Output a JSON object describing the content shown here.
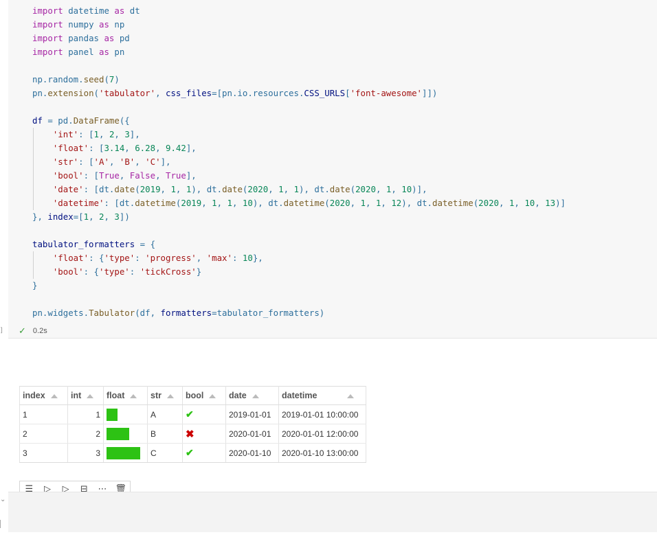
{
  "code_lines": [
    [
      {
        "t": "import",
        "c": "kw"
      },
      {
        "t": " datetime ",
        "c": "plain"
      },
      {
        "t": "as",
        "c": "kw"
      },
      {
        "t": " dt",
        "c": "plain"
      }
    ],
    [
      {
        "t": "import",
        "c": "kw"
      },
      {
        "t": " numpy ",
        "c": "plain"
      },
      {
        "t": "as",
        "c": "kw"
      },
      {
        "t": " np",
        "c": "plain"
      }
    ],
    [
      {
        "t": "import",
        "c": "kw"
      },
      {
        "t": " pandas ",
        "c": "plain"
      },
      {
        "t": "as",
        "c": "kw"
      },
      {
        "t": " pd",
        "c": "plain"
      }
    ],
    [
      {
        "t": "import",
        "c": "kw"
      },
      {
        "t": " panel ",
        "c": "plain"
      },
      {
        "t": "as",
        "c": "kw"
      },
      {
        "t": " pn",
        "c": "plain"
      }
    ],
    [],
    [
      {
        "t": "np.random.",
        "c": "plain"
      },
      {
        "t": "seed",
        "c": "fn"
      },
      {
        "t": "(",
        "c": "plain"
      },
      {
        "t": "7",
        "c": "num"
      },
      {
        "t": ")",
        "c": "plain"
      }
    ],
    [
      {
        "t": "pn.",
        "c": "plain"
      },
      {
        "t": "extension",
        "c": "fn"
      },
      {
        "t": "(",
        "c": "plain"
      },
      {
        "t": "'tabulator'",
        "c": "str"
      },
      {
        "t": ", ",
        "c": "plain"
      },
      {
        "t": "css_files",
        "c": "ident"
      },
      {
        "t": "=[pn.io.resources.",
        "c": "plain"
      },
      {
        "t": "CSS_URLS",
        "c": "ident"
      },
      {
        "t": "[",
        "c": "plain"
      },
      {
        "t": "'font-awesome'",
        "c": "str"
      },
      {
        "t": "]])",
        "c": "plain"
      }
    ],
    [],
    [
      {
        "t": "df ",
        "c": "ident"
      },
      {
        "t": "= pd.",
        "c": "plain"
      },
      {
        "t": "DataFrame",
        "c": "fn"
      },
      {
        "t": "({",
        "c": "plain"
      }
    ],
    [
      {
        "t": "    ",
        "c": "plain"
      },
      {
        "t": "'int'",
        "c": "str"
      },
      {
        "t": ": [",
        "c": "plain"
      },
      {
        "t": "1",
        "c": "num"
      },
      {
        "t": ", ",
        "c": "plain"
      },
      {
        "t": "2",
        "c": "num"
      },
      {
        "t": ", ",
        "c": "plain"
      },
      {
        "t": "3",
        "c": "num"
      },
      {
        "t": "],",
        "c": "plain"
      }
    ],
    [
      {
        "t": "    ",
        "c": "plain"
      },
      {
        "t": "'float'",
        "c": "str"
      },
      {
        "t": ": [",
        "c": "plain"
      },
      {
        "t": "3.14",
        "c": "num"
      },
      {
        "t": ", ",
        "c": "plain"
      },
      {
        "t": "6.28",
        "c": "num"
      },
      {
        "t": ", ",
        "c": "plain"
      },
      {
        "t": "9.42",
        "c": "num"
      },
      {
        "t": "],",
        "c": "plain"
      }
    ],
    [
      {
        "t": "    ",
        "c": "plain"
      },
      {
        "t": "'str'",
        "c": "str"
      },
      {
        "t": ": [",
        "c": "plain"
      },
      {
        "t": "'A'",
        "c": "str"
      },
      {
        "t": ", ",
        "c": "plain"
      },
      {
        "t": "'B'",
        "c": "str"
      },
      {
        "t": ", ",
        "c": "plain"
      },
      {
        "t": "'C'",
        "c": "str"
      },
      {
        "t": "],",
        "c": "plain"
      }
    ],
    [
      {
        "t": "    ",
        "c": "plain"
      },
      {
        "t": "'bool'",
        "c": "str"
      },
      {
        "t": ": [",
        "c": "plain"
      },
      {
        "t": "True",
        "c": "kw"
      },
      {
        "t": ", ",
        "c": "plain"
      },
      {
        "t": "False",
        "c": "kw"
      },
      {
        "t": ", ",
        "c": "plain"
      },
      {
        "t": "True",
        "c": "kw"
      },
      {
        "t": "],",
        "c": "plain"
      }
    ],
    [
      {
        "t": "    ",
        "c": "plain"
      },
      {
        "t": "'date'",
        "c": "str"
      },
      {
        "t": ": [dt.",
        "c": "plain"
      },
      {
        "t": "date",
        "c": "fn"
      },
      {
        "t": "(",
        "c": "plain"
      },
      {
        "t": "2019",
        "c": "num"
      },
      {
        "t": ", ",
        "c": "plain"
      },
      {
        "t": "1",
        "c": "num"
      },
      {
        "t": ", ",
        "c": "plain"
      },
      {
        "t": "1",
        "c": "num"
      },
      {
        "t": "), dt.",
        "c": "plain"
      },
      {
        "t": "date",
        "c": "fn"
      },
      {
        "t": "(",
        "c": "plain"
      },
      {
        "t": "2020",
        "c": "num"
      },
      {
        "t": ", ",
        "c": "plain"
      },
      {
        "t": "1",
        "c": "num"
      },
      {
        "t": ", ",
        "c": "plain"
      },
      {
        "t": "1",
        "c": "num"
      },
      {
        "t": "), dt.",
        "c": "plain"
      },
      {
        "t": "date",
        "c": "fn"
      },
      {
        "t": "(",
        "c": "plain"
      },
      {
        "t": "2020",
        "c": "num"
      },
      {
        "t": ", ",
        "c": "plain"
      },
      {
        "t": "1",
        "c": "num"
      },
      {
        "t": ", ",
        "c": "plain"
      },
      {
        "t": "10",
        "c": "num"
      },
      {
        "t": ")],",
        "c": "plain"
      }
    ],
    [
      {
        "t": "    ",
        "c": "plain"
      },
      {
        "t": "'datetime'",
        "c": "str"
      },
      {
        "t": ": [dt.",
        "c": "plain"
      },
      {
        "t": "datetime",
        "c": "fn"
      },
      {
        "t": "(",
        "c": "plain"
      },
      {
        "t": "2019",
        "c": "num"
      },
      {
        "t": ", ",
        "c": "plain"
      },
      {
        "t": "1",
        "c": "num"
      },
      {
        "t": ", ",
        "c": "plain"
      },
      {
        "t": "1",
        "c": "num"
      },
      {
        "t": ", ",
        "c": "plain"
      },
      {
        "t": "10",
        "c": "num"
      },
      {
        "t": "), dt.",
        "c": "plain"
      },
      {
        "t": "datetime",
        "c": "fn"
      },
      {
        "t": "(",
        "c": "plain"
      },
      {
        "t": "2020",
        "c": "num"
      },
      {
        "t": ", ",
        "c": "plain"
      },
      {
        "t": "1",
        "c": "num"
      },
      {
        "t": ", ",
        "c": "plain"
      },
      {
        "t": "1",
        "c": "num"
      },
      {
        "t": ", ",
        "c": "plain"
      },
      {
        "t": "12",
        "c": "num"
      },
      {
        "t": "), dt.",
        "c": "plain"
      },
      {
        "t": "datetime",
        "c": "fn"
      },
      {
        "t": "(",
        "c": "plain"
      },
      {
        "t": "2020",
        "c": "num"
      },
      {
        "t": ", ",
        "c": "plain"
      },
      {
        "t": "1",
        "c": "num"
      },
      {
        "t": ", ",
        "c": "plain"
      },
      {
        "t": "10",
        "c": "num"
      },
      {
        "t": ", ",
        "c": "plain"
      },
      {
        "t": "13",
        "c": "num"
      },
      {
        "t": ")]",
        "c": "plain"
      }
    ],
    [
      {
        "t": "}, ",
        "c": "plain"
      },
      {
        "t": "index",
        "c": "ident"
      },
      {
        "t": "=[",
        "c": "plain"
      },
      {
        "t": "1",
        "c": "num"
      },
      {
        "t": ", ",
        "c": "plain"
      },
      {
        "t": "2",
        "c": "num"
      },
      {
        "t": ", ",
        "c": "plain"
      },
      {
        "t": "3",
        "c": "num"
      },
      {
        "t": "])",
        "c": "plain"
      }
    ],
    [],
    [
      {
        "t": "tabulator_formatters ",
        "c": "ident"
      },
      {
        "t": "= {",
        "c": "plain"
      }
    ],
    [
      {
        "t": "    ",
        "c": "plain"
      },
      {
        "t": "'float'",
        "c": "str"
      },
      {
        "t": ": {",
        "c": "plain"
      },
      {
        "t": "'type'",
        "c": "str"
      },
      {
        "t": ": ",
        "c": "plain"
      },
      {
        "t": "'progress'",
        "c": "str"
      },
      {
        "t": ", ",
        "c": "plain"
      },
      {
        "t": "'max'",
        "c": "str"
      },
      {
        "t": ": ",
        "c": "plain"
      },
      {
        "t": "10",
        "c": "num"
      },
      {
        "t": "},",
        "c": "plain"
      }
    ],
    [
      {
        "t": "    ",
        "c": "plain"
      },
      {
        "t": "'bool'",
        "c": "str"
      },
      {
        "t": ": {",
        "c": "plain"
      },
      {
        "t": "'type'",
        "c": "str"
      },
      {
        "t": ": ",
        "c": "plain"
      },
      {
        "t": "'tickCross'",
        "c": "str"
      },
      {
        "t": "}",
        "c": "plain"
      }
    ],
    [
      {
        "t": "}",
        "c": "plain"
      }
    ],
    [],
    [
      {
        "t": "pn.widgets.",
        "c": "plain"
      },
      {
        "t": "Tabulator",
        "c": "fn"
      },
      {
        "t": "(df, ",
        "c": "plain"
      },
      {
        "t": "formatters",
        "c": "ident"
      },
      {
        "t": "=tabulator_formatters)",
        "c": "plain"
      }
    ]
  ],
  "exec_status": {
    "check": "✓",
    "duration": "0.2s"
  },
  "table": {
    "headers": [
      "index",
      "int",
      "float",
      "str",
      "bool",
      "date",
      "datetime"
    ],
    "float_max": 10,
    "rows": [
      {
        "index": "1",
        "int": "1",
        "float": 3.14,
        "str": "A",
        "bool": true,
        "date": "2019-01-01",
        "datetime": "2019-01-01 10:00:00"
      },
      {
        "index": "2",
        "int": "2",
        "float": 6.28,
        "str": "B",
        "bool": false,
        "date": "2020-01-01",
        "datetime": "2020-01-01 12:00:00"
      },
      {
        "index": "3",
        "int": "3",
        "float": 9.42,
        "str": "C",
        "bool": true,
        "date": "2020-01-10",
        "datetime": "2020-01-10 13:00:00"
      }
    ]
  },
  "toolbar": {
    "icons": [
      "format-list-icon",
      "run-above-icon",
      "run-below-icon",
      "split-cell-icon",
      "more-icon",
      "delete-icon"
    ],
    "glyphs": [
      "☰",
      "▷",
      "▷",
      "⊟",
      "⋯",
      "🗑"
    ]
  },
  "colors": {
    "progress": "#2dc214",
    "tick": "#2dc214",
    "cross": "#cc0000"
  }
}
